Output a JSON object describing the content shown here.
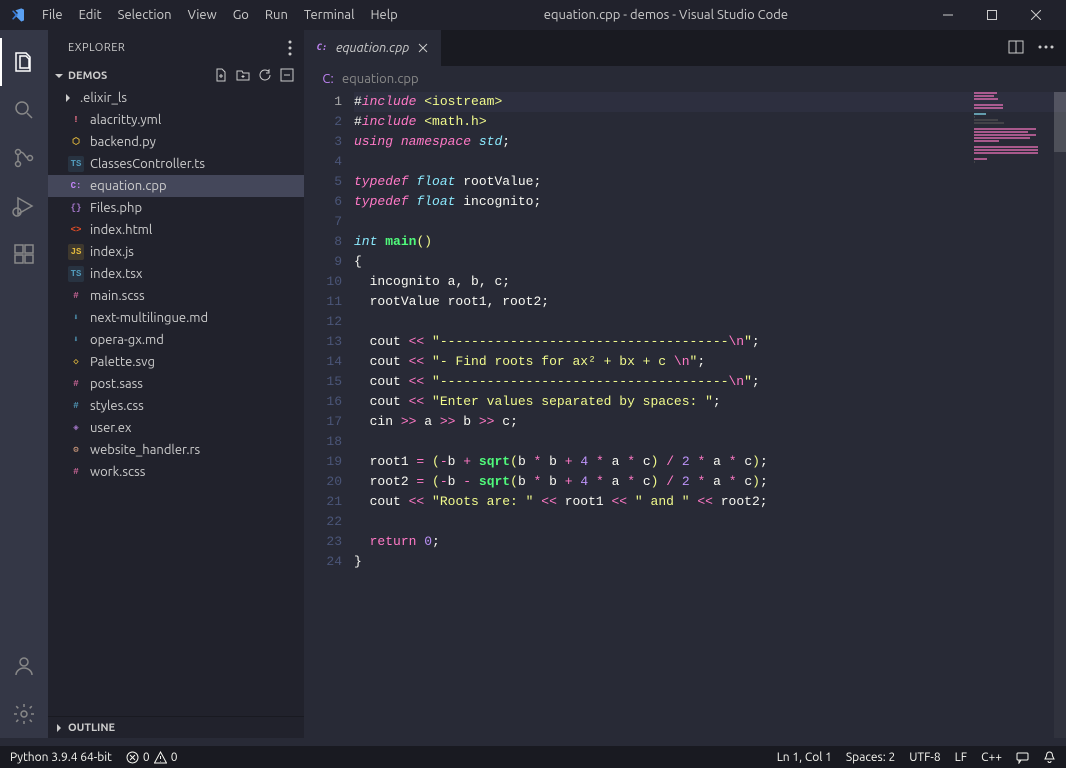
{
  "window": {
    "title": "equation.cpp - demos - Visual Studio Code"
  },
  "menu": [
    "File",
    "Edit",
    "Selection",
    "View",
    "Go",
    "Run",
    "Terminal",
    "Help"
  ],
  "explorer": {
    "title": "EXPLORER",
    "project": "DEMOS",
    "outline": "OUTLINE",
    "items": [
      {
        "name": ".elixir_ls",
        "type": "folder"
      },
      {
        "name": "alacritty.yml",
        "icon": "yml"
      },
      {
        "name": "backend.py",
        "icon": "py"
      },
      {
        "name": "ClassesController.ts",
        "icon": "ts"
      },
      {
        "name": "equation.cpp",
        "icon": "cpp",
        "selected": true
      },
      {
        "name": "Files.php",
        "icon": "php"
      },
      {
        "name": "index.html",
        "icon": "html"
      },
      {
        "name": "index.js",
        "icon": "js"
      },
      {
        "name": "index.tsx",
        "icon": "ts"
      },
      {
        "name": "main.scss",
        "icon": "scss"
      },
      {
        "name": "next-multilingue.md",
        "icon": "md"
      },
      {
        "name": "opera-gx.md",
        "icon": "md"
      },
      {
        "name": "Palette.svg",
        "icon": "svg"
      },
      {
        "name": "post.sass",
        "icon": "sass"
      },
      {
        "name": "styles.css",
        "icon": "css"
      },
      {
        "name": "user.ex",
        "icon": "ex"
      },
      {
        "name": "website_handler.rs",
        "icon": "rs"
      },
      {
        "name": "work.scss",
        "icon": "scss"
      }
    ]
  },
  "tabs": [
    {
      "name": "equation.cpp",
      "icon": "cpp",
      "italic": true
    }
  ],
  "breadcrumb": {
    "file": "equation.cpp"
  },
  "code": {
    "lines": [
      [
        {
          "c": "punct",
          "t": "#"
        },
        {
          "c": "pre",
          "t": "include"
        },
        {
          "c": "punct",
          "t": " "
        },
        {
          "c": "str",
          "t": "<iostream>"
        }
      ],
      [
        {
          "c": "punct",
          "t": "#"
        },
        {
          "c": "pre",
          "t": "include"
        },
        {
          "c": "punct",
          "t": " "
        },
        {
          "c": "str",
          "t": "<math.h>"
        }
      ],
      [
        {
          "c": "kwi",
          "t": "using"
        },
        {
          "c": "punct",
          "t": " "
        },
        {
          "c": "kwi",
          "t": "namespace"
        },
        {
          "c": "punct",
          "t": " "
        },
        {
          "c": "type",
          "t": "std"
        },
        {
          "c": "punct",
          "t": ";"
        }
      ],
      [],
      [
        {
          "c": "kwi",
          "t": "typedef"
        },
        {
          "c": "punct",
          "t": " "
        },
        {
          "c": "type",
          "t": "float"
        },
        {
          "c": "punct",
          "t": " "
        },
        {
          "c": "ident",
          "t": "rootValue"
        },
        {
          "c": "punct",
          "t": ";"
        }
      ],
      [
        {
          "c": "kwi",
          "t": "typedef"
        },
        {
          "c": "punct",
          "t": " "
        },
        {
          "c": "type",
          "t": "float"
        },
        {
          "c": "punct",
          "t": " "
        },
        {
          "c": "ident",
          "t": "incognito"
        },
        {
          "c": "punct",
          "t": ";"
        }
      ],
      [],
      [
        {
          "c": "type",
          "t": "int"
        },
        {
          "c": "punct",
          "t": " "
        },
        {
          "c": "fn",
          "t": "main"
        },
        {
          "c": "str",
          "t": "()"
        }
      ],
      [
        {
          "c": "punct",
          "t": "{"
        }
      ],
      [
        {
          "c": "punct",
          "t": "  "
        },
        {
          "c": "ident",
          "t": "incognito a"
        },
        {
          "c": "punct",
          "t": ","
        },
        {
          "c": "ident",
          "t": " b"
        },
        {
          "c": "punct",
          "t": ","
        },
        {
          "c": "ident",
          "t": " c"
        },
        {
          "c": "punct",
          "t": ";"
        }
      ],
      [
        {
          "c": "punct",
          "t": "  "
        },
        {
          "c": "ident",
          "t": "rootValue root1"
        },
        {
          "c": "punct",
          "t": ","
        },
        {
          "c": "ident",
          "t": " root2"
        },
        {
          "c": "punct",
          "t": ";"
        }
      ],
      [],
      [
        {
          "c": "punct",
          "t": "  "
        },
        {
          "c": "ident",
          "t": "cout "
        },
        {
          "c": "op",
          "t": "<<"
        },
        {
          "c": "punct",
          "t": " "
        },
        {
          "c": "str",
          "t": "\"-------------------------------------"
        },
        {
          "c": "esc",
          "t": "\\n"
        },
        {
          "c": "str",
          "t": "\""
        },
        {
          "c": "punct",
          "t": ";"
        }
      ],
      [
        {
          "c": "punct",
          "t": "  "
        },
        {
          "c": "ident",
          "t": "cout "
        },
        {
          "c": "op",
          "t": "<<"
        },
        {
          "c": "punct",
          "t": " "
        },
        {
          "c": "str",
          "t": "\"- Find roots for ax² + bx + c "
        },
        {
          "c": "esc",
          "t": "\\n"
        },
        {
          "c": "str",
          "t": "\""
        },
        {
          "c": "punct",
          "t": ";"
        }
      ],
      [
        {
          "c": "punct",
          "t": "  "
        },
        {
          "c": "ident",
          "t": "cout "
        },
        {
          "c": "op",
          "t": "<<"
        },
        {
          "c": "punct",
          "t": " "
        },
        {
          "c": "str",
          "t": "\"-------------------------------------"
        },
        {
          "c": "esc",
          "t": "\\n"
        },
        {
          "c": "str",
          "t": "\""
        },
        {
          "c": "punct",
          "t": ";"
        }
      ],
      [
        {
          "c": "punct",
          "t": "  "
        },
        {
          "c": "ident",
          "t": "cout "
        },
        {
          "c": "op",
          "t": "<<"
        },
        {
          "c": "punct",
          "t": " "
        },
        {
          "c": "str",
          "t": "\"Enter values separated by spaces: \""
        },
        {
          "c": "punct",
          "t": ";"
        }
      ],
      [
        {
          "c": "punct",
          "t": "  "
        },
        {
          "c": "ident",
          "t": "cin "
        },
        {
          "c": "op",
          "t": ">>"
        },
        {
          "c": "ident",
          "t": " a "
        },
        {
          "c": "op",
          "t": ">>"
        },
        {
          "c": "ident",
          "t": " b "
        },
        {
          "c": "op",
          "t": ">>"
        },
        {
          "c": "ident",
          "t": " c"
        },
        {
          "c": "punct",
          "t": ";"
        }
      ],
      [],
      [
        {
          "c": "punct",
          "t": "  "
        },
        {
          "c": "ident",
          "t": "root1 "
        },
        {
          "c": "op",
          "t": "="
        },
        {
          "c": "punct",
          "t": " "
        },
        {
          "c": "str",
          "t": "("
        },
        {
          "c": "op",
          "t": "-"
        },
        {
          "c": "ident",
          "t": "b "
        },
        {
          "c": "op",
          "t": "+"
        },
        {
          "c": "punct",
          "t": " "
        },
        {
          "c": "fn",
          "t": "sqrt"
        },
        {
          "c": "str",
          "t": "("
        },
        {
          "c": "ident",
          "t": "b "
        },
        {
          "c": "op",
          "t": "*"
        },
        {
          "c": "ident",
          "t": " b "
        },
        {
          "c": "op",
          "t": "+"
        },
        {
          "c": "punct",
          "t": " "
        },
        {
          "c": "num",
          "t": "4"
        },
        {
          "c": "punct",
          "t": " "
        },
        {
          "c": "op",
          "t": "*"
        },
        {
          "c": "ident",
          "t": " a "
        },
        {
          "c": "op",
          "t": "*"
        },
        {
          "c": "ident",
          "t": " c"
        },
        {
          "c": "str",
          "t": ")"
        },
        {
          "c": "punct",
          "t": " "
        },
        {
          "c": "op",
          "t": "/"
        },
        {
          "c": "punct",
          "t": " "
        },
        {
          "c": "num",
          "t": "2"
        },
        {
          "c": "punct",
          "t": " "
        },
        {
          "c": "op",
          "t": "*"
        },
        {
          "c": "ident",
          "t": " a "
        },
        {
          "c": "op",
          "t": "*"
        },
        {
          "c": "ident",
          "t": " c"
        },
        {
          "c": "str",
          "t": ")"
        },
        {
          "c": "punct",
          "t": ";"
        }
      ],
      [
        {
          "c": "punct",
          "t": "  "
        },
        {
          "c": "ident",
          "t": "root2 "
        },
        {
          "c": "op",
          "t": "="
        },
        {
          "c": "punct",
          "t": " "
        },
        {
          "c": "str",
          "t": "("
        },
        {
          "c": "op",
          "t": "-"
        },
        {
          "c": "ident",
          "t": "b "
        },
        {
          "c": "op",
          "t": "-"
        },
        {
          "c": "punct",
          "t": " "
        },
        {
          "c": "fn",
          "t": "sqrt"
        },
        {
          "c": "str",
          "t": "("
        },
        {
          "c": "ident",
          "t": "b "
        },
        {
          "c": "op",
          "t": "*"
        },
        {
          "c": "ident",
          "t": " b "
        },
        {
          "c": "op",
          "t": "+"
        },
        {
          "c": "punct",
          "t": " "
        },
        {
          "c": "num",
          "t": "4"
        },
        {
          "c": "punct",
          "t": " "
        },
        {
          "c": "op",
          "t": "*"
        },
        {
          "c": "ident",
          "t": " a "
        },
        {
          "c": "op",
          "t": "*"
        },
        {
          "c": "ident",
          "t": " c"
        },
        {
          "c": "str",
          "t": ")"
        },
        {
          "c": "punct",
          "t": " "
        },
        {
          "c": "op",
          "t": "/"
        },
        {
          "c": "punct",
          "t": " "
        },
        {
          "c": "num",
          "t": "2"
        },
        {
          "c": "punct",
          "t": " "
        },
        {
          "c": "op",
          "t": "*"
        },
        {
          "c": "ident",
          "t": " a "
        },
        {
          "c": "op",
          "t": "*"
        },
        {
          "c": "ident",
          "t": " c"
        },
        {
          "c": "str",
          "t": ")"
        },
        {
          "c": "punct",
          "t": ";"
        }
      ],
      [
        {
          "c": "punct",
          "t": "  "
        },
        {
          "c": "ident",
          "t": "cout "
        },
        {
          "c": "op",
          "t": "<<"
        },
        {
          "c": "punct",
          "t": " "
        },
        {
          "c": "str",
          "t": "\"Roots are: \""
        },
        {
          "c": "punct",
          "t": " "
        },
        {
          "c": "op",
          "t": "<<"
        },
        {
          "c": "ident",
          "t": " root1 "
        },
        {
          "c": "op",
          "t": "<<"
        },
        {
          "c": "punct",
          "t": " "
        },
        {
          "c": "str",
          "t": "\" and \""
        },
        {
          "c": "punct",
          "t": " "
        },
        {
          "c": "op",
          "t": "<<"
        },
        {
          "c": "ident",
          "t": " root2"
        },
        {
          "c": "punct",
          "t": ";"
        }
      ],
      [],
      [
        {
          "c": "punct",
          "t": "  "
        },
        {
          "c": "kw",
          "t": "return"
        },
        {
          "c": "punct",
          "t": " "
        },
        {
          "c": "num",
          "t": "0"
        },
        {
          "c": "punct",
          "t": ";"
        }
      ],
      [
        {
          "c": "punct",
          "t": "}"
        }
      ]
    ],
    "active_line": 1
  },
  "status": {
    "python": "Python 3.9.4 64-bit",
    "errors": "0",
    "warnings": "0",
    "cursor": "Ln 1, Col 1",
    "spaces": "Spaces: 2",
    "encoding": "UTF-8",
    "eol": "LF",
    "lang": "C++"
  },
  "icon_glyphs": {
    "cpp": "C:",
    "py": "⬡",
    "ts": "TS",
    "php": "{}",
    "html": "<>",
    "js": "JS",
    "scss": "#",
    "md": "⬇",
    "css": "#",
    "ex": "◈",
    "rs": "⚙",
    "svg": "◇",
    "sass": "#",
    "yml": "!"
  }
}
